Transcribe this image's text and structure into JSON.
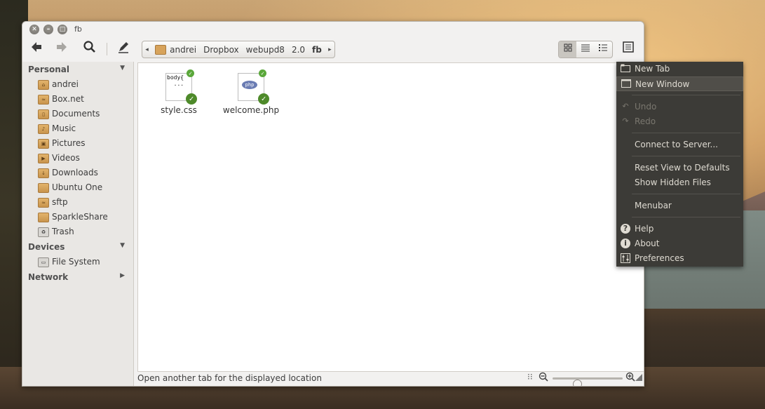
{
  "window": {
    "title": "fb",
    "close_glyph": "✕",
    "minimize_glyph": "–",
    "maximize_glyph": "□"
  },
  "toolbar": {
    "back_icon": "back-arrow-icon",
    "forward_icon": "forward-arrow-icon",
    "search_icon": "search-icon",
    "edit_icon": "pencil-icon",
    "path": [
      "andrei",
      "Dropbox",
      "webupd8",
      "2.0",
      "fb"
    ],
    "path_left_arrow": "◂",
    "path_right_arrow": "▸",
    "views": [
      "icon-view",
      "list-view",
      "compact-view"
    ],
    "active_view": "icon-view"
  },
  "sidebar": {
    "sections": [
      {
        "title": "Personal",
        "expanded": true,
        "items": [
          {
            "label": "andrei",
            "icon": "home-folder-icon"
          },
          {
            "label": "Box.net",
            "icon": "network-folder-icon"
          },
          {
            "label": "Documents",
            "icon": "documents-folder-icon"
          },
          {
            "label": "Music",
            "icon": "music-folder-icon"
          },
          {
            "label": "Pictures",
            "icon": "pictures-folder-icon"
          },
          {
            "label": "Videos",
            "icon": "videos-folder-icon"
          },
          {
            "label": "Downloads",
            "icon": "downloads-folder-icon"
          },
          {
            "label": "Ubuntu One",
            "icon": "folder-icon"
          },
          {
            "label": "sftp",
            "icon": "network-folder-icon"
          },
          {
            "label": "SparkleShare",
            "icon": "folder-icon"
          },
          {
            "label": "Trash",
            "icon": "trash-icon"
          }
        ]
      },
      {
        "title": "Devices",
        "expanded": true,
        "items": [
          {
            "label": "File System",
            "icon": "drive-icon"
          }
        ]
      },
      {
        "title": "Network",
        "expanded": false,
        "items": []
      }
    ]
  },
  "files": [
    {
      "name": "style.css",
      "preview": "body{\n  ...",
      "emblem": "synced-check"
    },
    {
      "name": "welcome.php",
      "preview": "php",
      "emblem": "synced-check"
    }
  ],
  "statusbar": {
    "text": "Open another tab for the displayed location",
    "zoom_level": 0.35
  },
  "menu": {
    "items": [
      {
        "label": "New Tab",
        "icon": "new-tab-icon",
        "state": "normal"
      },
      {
        "label": "New Window",
        "icon": "new-window-icon",
        "state": "hover"
      },
      {
        "separator": true
      },
      {
        "label": "Undo",
        "icon": "undo-icon",
        "state": "disabled"
      },
      {
        "label": "Redo",
        "icon": "redo-icon",
        "state": "disabled"
      },
      {
        "separator": true
      },
      {
        "label": "Connect to Server...",
        "icon": "",
        "state": "normal"
      },
      {
        "separator": true
      },
      {
        "label": "Reset View to Defaults",
        "icon": "",
        "state": "normal"
      },
      {
        "label": "Show Hidden Files",
        "icon": "",
        "state": "normal"
      },
      {
        "separator": true
      },
      {
        "label": "Menubar",
        "icon": "",
        "state": "normal"
      },
      {
        "separator": true
      },
      {
        "label": "Help",
        "icon": "help-icon",
        "state": "normal"
      },
      {
        "label": "About",
        "icon": "info-icon",
        "state": "normal"
      },
      {
        "label": "Preferences",
        "icon": "preferences-icon",
        "state": "normal"
      }
    ]
  },
  "colors": {
    "menu_bg": "#3c3b37",
    "menu_text": "#dfdbd2",
    "window_bg": "#f2f1f0",
    "emblem_green": "#4e8a2a"
  }
}
